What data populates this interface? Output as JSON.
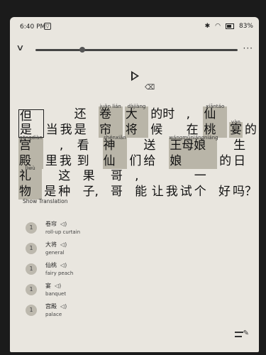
{
  "status": {
    "time": "6:40 PM",
    "box_glyph": "▽",
    "battery": "83%"
  },
  "sentence": {
    "line1": [
      {
        "text": "但是",
        "pinyin": "",
        "hl": false,
        "boxed": true
      },
      {
        "text": "当",
        "pinyin": "",
        "hl": false,
        "boxed": false
      },
      {
        "text": "我",
        "pinyin": "",
        "hl": false,
        "boxed": false
      },
      {
        "text": "还是",
        "pinyin": "",
        "hl": false,
        "boxed": false
      },
      {
        "text": "卷帘",
        "pinyin": "juǎn lián",
        "hl": true,
        "boxed": false
      },
      {
        "text": "大将",
        "pinyin": "dàjiàng",
        "hl": true,
        "boxed": false
      },
      {
        "text": "的时候",
        "pinyin": "",
        "hl": false,
        "boxed": false
      },
      {
        "text": ",在",
        "pinyin": "",
        "hl": false,
        "boxed": false
      },
      {
        "text": "仙桃",
        "pinyin": "xiāntáo",
        "hl": true,
        "boxed": false
      },
      {
        "text": "宴",
        "pinyin": "yàn",
        "hl": true,
        "boxed": false
      },
      {
        "text": "的",
        "pinyin": "",
        "hl": false,
        "boxed": false
      }
    ],
    "line2": [
      {
        "text": "宫殿",
        "pinyin": "gōngdiàn",
        "hl": true,
        "boxed": false
      },
      {
        "text": "里",
        "pinyin": "",
        "hl": false,
        "boxed": false
      },
      {
        "text": ",我",
        "pinyin": "",
        "hl": false,
        "boxed": false
      },
      {
        "text": "看到",
        "pinyin": "",
        "hl": false,
        "boxed": false
      },
      {
        "text": "神仙",
        "pinyin": "shénxiān",
        "hl": true,
        "boxed": false
      },
      {
        "text": "们",
        "pinyin": "",
        "hl": false,
        "boxed": false
      },
      {
        "text": "送给",
        "pinyin": "",
        "hl": false,
        "boxed": false
      },
      {
        "text": "王母娘娘",
        "pinyin": "wángmǔniángniáng",
        "hl": true,
        "boxed": false
      },
      {
        "text": "的",
        "pinyin": "",
        "hl": false,
        "boxed": false
      },
      {
        "text": "生日",
        "pinyin": "",
        "hl": false,
        "boxed": false
      }
    ],
    "line3": [
      {
        "text": "礼物",
        "pinyin": "lǐwù",
        "hl": true,
        "boxed": false
      },
      {
        "text": "是",
        "pinyin": "",
        "hl": false,
        "boxed": false
      },
      {
        "text": "这种",
        "pinyin": "",
        "hl": false,
        "boxed": false
      },
      {
        "text": "果子,",
        "pinyin": "",
        "hl": false,
        "boxed": false
      },
      {
        "text": "哥哥",
        "pinyin": "",
        "hl": false,
        "boxed": false
      },
      {
        "text": ",能",
        "pinyin": "",
        "hl": false,
        "boxed": false
      },
      {
        "text": "让",
        "pinyin": "",
        "hl": false,
        "boxed": false
      },
      {
        "text": "我",
        "pinyin": "",
        "hl": false,
        "boxed": false
      },
      {
        "text": "试",
        "pinyin": "",
        "hl": false,
        "boxed": false
      },
      {
        "text": "一个",
        "pinyin": "",
        "hl": false,
        "boxed": false
      },
      {
        "text": "好",
        "pinyin": "",
        "hl": false,
        "boxed": false
      },
      {
        "text": "吗？",
        "pinyin": "",
        "hl": false,
        "boxed": false
      }
    ]
  },
  "show_translation_label": "Show Translation",
  "vocab": [
    {
      "num": "1",
      "word": "卷帘",
      "meaning": "roll-up curtain"
    },
    {
      "num": "1",
      "word": "大将",
      "meaning": "general"
    },
    {
      "num": "1",
      "word": "仙桃",
      "meaning": "fairy peach"
    },
    {
      "num": "1",
      "word": "宴",
      "meaning": "banquet"
    },
    {
      "num": "1",
      "word": "宫殿",
      "meaning": "palace"
    }
  ]
}
